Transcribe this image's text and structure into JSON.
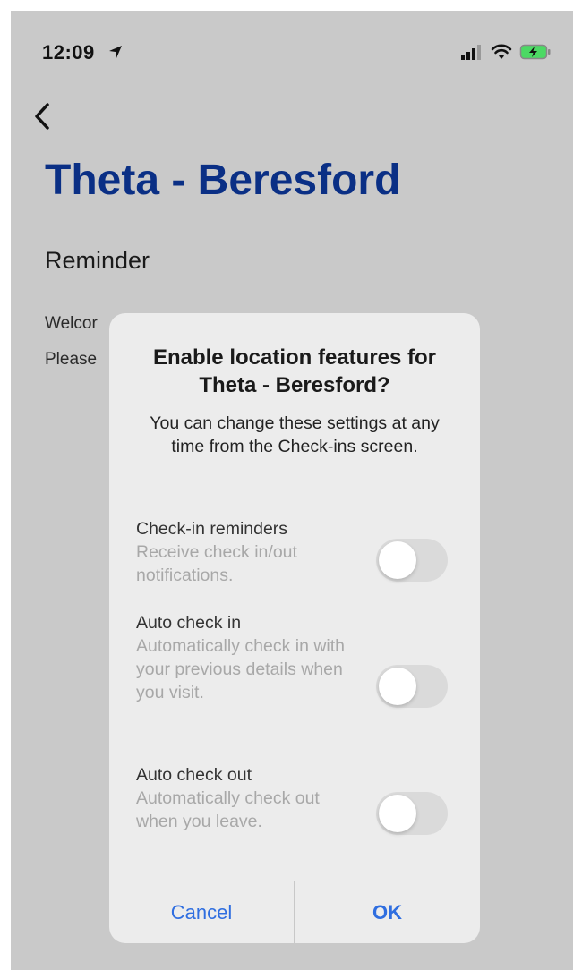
{
  "status_bar": {
    "time": "12:09",
    "icons": [
      "location-arrow-icon",
      "signal-icon",
      "wifi-icon",
      "battery-charging-icon"
    ]
  },
  "nav": {
    "back_icon": "chevron-left-icon"
  },
  "page": {
    "title": "Theta - Beresford",
    "section_heading": "Reminder",
    "body_line_1": "Welcor",
    "body_line_2": "Please"
  },
  "alert": {
    "title": "Enable location features for Theta - Beresford?",
    "message": "You can change these settings at any time from the Check-ins screen.",
    "options": [
      {
        "title": "Check-in reminders",
        "description": "Receive check in/out notifications.",
        "enabled": false
      },
      {
        "title": "Auto check in",
        "description": "Automatically check in with your previous details when you visit.",
        "enabled": false
      },
      {
        "title": "Auto check out",
        "description": "Automatically check out when you leave.",
        "enabled": false
      }
    ],
    "cancel_label": "Cancel",
    "ok_label": "OK"
  },
  "colors": {
    "background_dim": "#c9c9c9",
    "title_blue": "#0a2f85",
    "button_blue": "#2f6ee0",
    "battery_green": "#4cd964"
  }
}
